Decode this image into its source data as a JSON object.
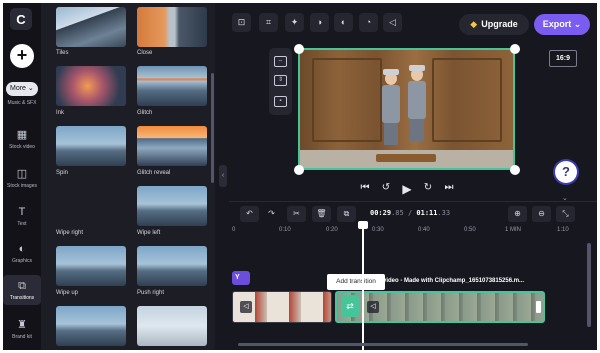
{
  "rail": {
    "logo": "C",
    "more": "More ⌄",
    "items": [
      {
        "label": "Music & SFX",
        "icon": "music-icon"
      },
      {
        "label": "Stock video",
        "icon": "film-icon"
      },
      {
        "label": "Stock images",
        "icon": "image-icon"
      },
      {
        "label": "Text",
        "icon": "text-icon"
      },
      {
        "label": "Graphics",
        "icon": "shapes-icon"
      },
      {
        "label": "Transitions",
        "icon": "transitions-icon"
      },
      {
        "label": "Brand kit",
        "icon": "brand-icon"
      }
    ]
  },
  "transitions": [
    {
      "label": "Tiles"
    },
    {
      "label": "Close"
    },
    {
      "label": "Ink"
    },
    {
      "label": "Glitch"
    },
    {
      "label": "Spin"
    },
    {
      "label": "Glitch reveal"
    },
    {
      "label": "Wipe right"
    },
    {
      "label": "Wipe left"
    },
    {
      "label": "Wipe up"
    },
    {
      "label": "Push right"
    }
  ],
  "header": {
    "upgrade": "Upgrade",
    "export": "Export",
    "aspect_ratio": "16:9"
  },
  "timeline": {
    "current_time": "00:29",
    "current_frac": ".85",
    "separator": " / ",
    "total_time": "01:11",
    "total_frac": ".33",
    "ruler": [
      "0",
      "0:10",
      "0:20",
      "0:30",
      "0:40",
      "0:50",
      "1 MIN",
      "1:10"
    ],
    "caption_chip": "Y",
    "clip_title": "video - Made with Clipchamp_1651073815256.m...",
    "tooltip": "Add transition"
  },
  "help_label": "?"
}
